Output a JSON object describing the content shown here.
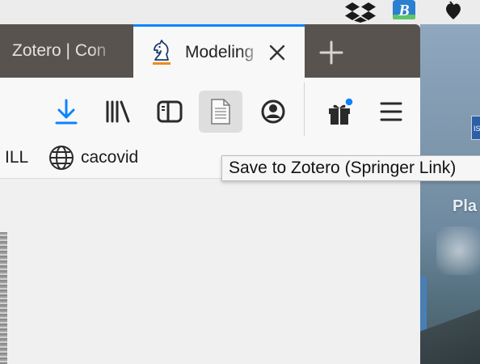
{
  "menubar": {
    "icons": [
      "dropbox-icon",
      "b-app-icon",
      "heart-app-icon"
    ]
  },
  "tabs": [
    {
      "title": "Zotero | Con",
      "active": false
    },
    {
      "title": "Modeling",
      "active": true,
      "favicon": "knight-chess-icon"
    }
  ],
  "toolbar": {
    "buttons": [
      "download-icon",
      "library-icon",
      "sidebar-icon",
      "page-save-icon",
      "account-icon",
      "gift-icon",
      "menu-icon"
    ]
  },
  "bookmarks": {
    "items": [
      {
        "label": "ILL"
      },
      {
        "label": "cacovid",
        "icon": "globe-icon"
      }
    ]
  },
  "tooltip": {
    "text": "Save to Zotero (Springer Link)"
  },
  "desktop": {
    "text": "Pla"
  },
  "colors": {
    "accent": "#0a84ff",
    "tabbar": "#58534e",
    "notification": "#0a84ff"
  }
}
